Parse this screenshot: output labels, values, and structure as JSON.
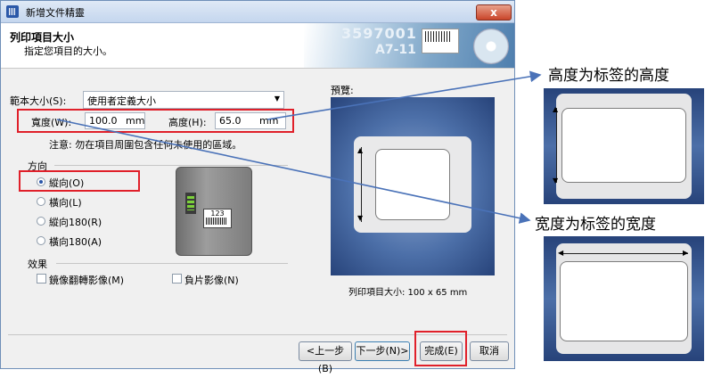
{
  "window": {
    "title": "新增文件精靈",
    "close_glyph": "x"
  },
  "header": {
    "title": "列印項目大小",
    "subtitle": "指定您項目的大小。",
    "banner_number_1": "3597001",
    "banner_number_2": "A7-11"
  },
  "form": {
    "size_label": "範本大小(S):",
    "size_value": "使用者定義大小",
    "width_label": "寬度(W):",
    "width_value": "100.0",
    "width_unit": "mm",
    "height_label": "高度(H):",
    "height_value": "65.0",
    "height_unit": "mm",
    "note": "注意: 勿在項目周圍包含任何未使用的區域。"
  },
  "orientation": {
    "label": "方向",
    "options": [
      {
        "label": "縱向(O)",
        "selected": true
      },
      {
        "label": "橫向(L)",
        "selected": false
      },
      {
        "label": "縱向180(R)",
        "selected": false
      },
      {
        "label": "橫向180(A)",
        "selected": false
      }
    ]
  },
  "effects": {
    "label": "效果",
    "options": [
      {
        "label": "鏡像翻轉影像(M)",
        "checked": false
      },
      {
        "label": "負片影像(N)",
        "checked": false
      }
    ]
  },
  "printer_label_text": "123",
  "preview": {
    "label": "預覽:",
    "size_text": "列印項目大小: 100 x 65 mm"
  },
  "buttons": {
    "back": "<上一步(B)",
    "next": "下一步(N)>",
    "finish": "完成(E)",
    "cancel": "取消"
  },
  "annotations": {
    "height_note": "高度为标签的高度",
    "width_note": "宽度为标签的宽度"
  },
  "colors": {
    "highlight": "#e0202a",
    "arrow": "#4a72b8",
    "preview_bg": "#4c6fa8"
  }
}
